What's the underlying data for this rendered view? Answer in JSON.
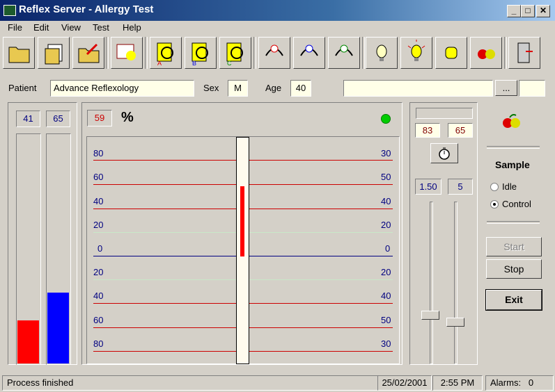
{
  "window": {
    "title": "Reflex Server - Allergy Test",
    "icon_text": "RS"
  },
  "menu": [
    "File",
    "Edit",
    "View",
    "Test",
    "Help"
  ],
  "toolbar": {
    "icons": [
      "open-folder-icon",
      "document-stack-icon",
      "folder-send-icon",
      "calendar-bulb-icon",
      "magnifier-doc-a-icon",
      "magnifier-doc-b-icon",
      "magnifier-doc-c-icon",
      "headset-a-icon",
      "headset-b-icon",
      "headset-c-icon",
      "bulb-off-icon",
      "bulb-on-icon",
      "hand-icon",
      "fruit-icon",
      "exit-door-icon"
    ]
  },
  "patient": {
    "label": "Patient",
    "name": "Advance Reflexology",
    "sex_label": "Sex",
    "sex": "M",
    "age_label": "Age",
    "age": "40",
    "browse_label": "..."
  },
  "bars": {
    "left_value": "41",
    "right_value": "65"
  },
  "meter": {
    "percent_value": "59",
    "percent_symbol": "%",
    "left_scale": [
      "80",
      "60",
      "40",
      "20",
      "0",
      "20",
      "40",
      "60",
      "80"
    ],
    "right_scale": [
      "30",
      "50",
      "40",
      "20",
      "0",
      "20",
      "40",
      "50",
      "30"
    ]
  },
  "controls": {
    "val_a": "83",
    "val_b": "65",
    "val_c": "1.50",
    "val_d": "5"
  },
  "sample": {
    "title": "Sample",
    "idle_label": "Idle",
    "control_label": "Control",
    "selected": "Control",
    "start_label": "Start",
    "stop_label": "Stop",
    "exit_label": "Exit"
  },
  "status": {
    "message": "Process finished",
    "date": "25/02/2001",
    "time": "2:55 PM",
    "alarms": "Alarms:   0"
  },
  "colors": {
    "red": "#ff0000",
    "blue": "#0000ff",
    "scale_line": "#cc0000",
    "zero_line": "#000080",
    "indicator": "#00cc00"
  }
}
